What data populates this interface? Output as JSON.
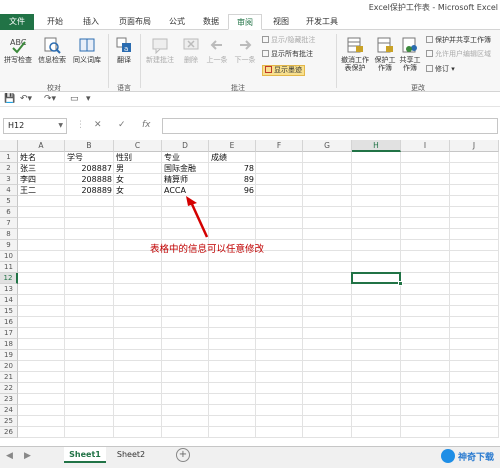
{
  "window": {
    "title": "Excel保护工作表 - Microsoft Excel"
  },
  "tabs": [
    {
      "label": "文件",
      "type": "file"
    },
    {
      "label": "开始"
    },
    {
      "label": "插入"
    },
    {
      "label": "页面布局"
    },
    {
      "label": "公式"
    },
    {
      "label": "数据"
    },
    {
      "label": "审阅",
      "active": true
    },
    {
      "label": "视图"
    },
    {
      "label": "开发工具"
    }
  ],
  "ribbon": {
    "groups": {
      "proofing": "校对",
      "language": "语言",
      "comments": "批注",
      "changes": "更改"
    },
    "buttons": {
      "spelling": "拼写检查",
      "research": "信息检索",
      "thesaurus": "同义词库",
      "translate": "翻译",
      "new_comment": "新建批注",
      "delete_comment": "删除",
      "prev_comment": "上一条",
      "next_comment": "下一条",
      "show_hide_comment": "显示/隐藏批注",
      "show_all_comments": "显示所有批注",
      "show_ink": "显示墨迹",
      "unprotect_sheet": "撤消工作表保护",
      "protect_workbook": "保护工作簿",
      "share_workbook": "共享工作簿",
      "protect_and_share": "保护并共享工作簿",
      "allow_edit_ranges": "允许用户编辑区域",
      "track_changes": "修订"
    }
  },
  "formula_bar": {
    "name_box": "H12",
    "fx": "fx",
    "value": ""
  },
  "columns": [
    "A",
    "B",
    "C",
    "D",
    "E",
    "F",
    "G",
    "H",
    "I",
    "J"
  ],
  "selected_column": "H",
  "rows": [
    "1",
    "2",
    "3",
    "4",
    "5",
    "6",
    "7",
    "8",
    "9",
    "10",
    "11",
    "12",
    "13",
    "14",
    "15",
    "16",
    "17",
    "18",
    "19",
    "20",
    "21",
    "22",
    "23",
    "24",
    "25",
    "26"
  ],
  "selected_row": "12",
  "table": {
    "headers": [
      "姓名",
      "学号",
      "性别",
      "专业",
      "成绩"
    ],
    "rows": [
      [
        "张三",
        "208887",
        "男",
        "国际金融",
        "78"
      ],
      [
        "李四",
        "208888",
        "女",
        "精算师",
        "89"
      ],
      [
        "王二",
        "208889",
        "女",
        "ACCA",
        "96"
      ]
    ]
  },
  "annotation": "表格中的信息可以任意修改",
  "sheets": [
    {
      "label": "Sheet1",
      "active": true
    },
    {
      "label": "Sheet2"
    }
  ],
  "watermark": "神奇下载",
  "colors": {
    "accent": "#217346",
    "annotation": "#c00000",
    "arrow": "#d40000"
  }
}
